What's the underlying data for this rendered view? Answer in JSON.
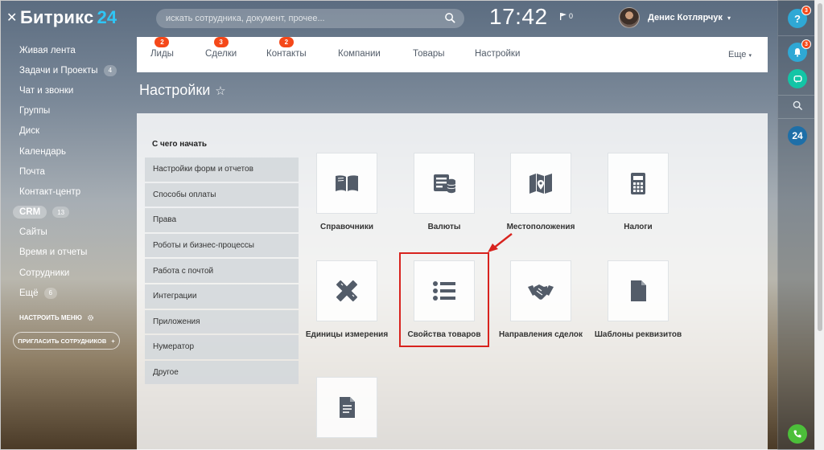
{
  "app": {
    "logo_text": "Битрикс",
    "logo_num": "24",
    "close_glyph": "✕"
  },
  "topbar": {
    "search_placeholder": "искать сотрудника, документ, прочее...",
    "time": "17:42",
    "flag_count": "0",
    "user_name": "Денис Котлярчук"
  },
  "leftnav": {
    "items": [
      {
        "label": "Живая лента"
      },
      {
        "label": "Задачи и Проекты",
        "count": "4"
      },
      {
        "label": "Чат и звонки"
      },
      {
        "label": "Группы"
      },
      {
        "label": "Диск"
      },
      {
        "label": "Календарь"
      },
      {
        "label": "Почта"
      },
      {
        "label": "Контакт-центр"
      },
      {
        "label": "CRM",
        "count": "13"
      },
      {
        "label": "Сайты"
      },
      {
        "label": "Время и отчеты"
      },
      {
        "label": "Сотрудники"
      },
      {
        "label": "Ещё",
        "count": "6"
      }
    ],
    "setup_label": "НАСТРОИТЬ МЕНЮ",
    "invite_label": "ПРИГЛАСИТЬ СОТРУДНИКОВ",
    "invite_plus": "+"
  },
  "rightbar": {
    "help_badge": "3",
    "bell_badge": "3",
    "help_glyph": "?",
    "b24_glyph": "24"
  },
  "crm_tabs": {
    "tabs": [
      {
        "label": "Лиды",
        "badge": "2"
      },
      {
        "label": "Сделки",
        "badge": "3"
      },
      {
        "label": "Контакты",
        "badge": "2"
      },
      {
        "label": "Компании"
      },
      {
        "label": "Товары"
      },
      {
        "label": "Настройки"
      }
    ],
    "more_label": "Еще"
  },
  "page": {
    "title": "Настройки",
    "star_glyph": "☆"
  },
  "settings": {
    "start_heading": "С чего начать",
    "menu": [
      "Настройки форм и отчетов",
      "Способы оплаты",
      "Права",
      "Роботы и бизнес-процессы",
      "Работа с почтой",
      "Интеграции",
      "Приложения",
      "Нумератор",
      "Другое"
    ],
    "tiles": [
      {
        "label": "Справочники",
        "icon": "book-icon"
      },
      {
        "label": "Валюты",
        "icon": "currency-icon"
      },
      {
        "label": "Местоположения",
        "icon": "map-pin-icon"
      },
      {
        "label": "Налоги",
        "icon": "calculator-icon"
      },
      {
        "label": "Единицы измерения",
        "icon": "ruler-pencil-icon"
      },
      {
        "label": "Свойства товаров",
        "icon": "list-icon"
      },
      {
        "label": "Направления сделок",
        "icon": "handshake-icon"
      },
      {
        "label": "Шаблоны реквизитов",
        "icon": "file-icon"
      },
      {
        "label": "",
        "icon": "document-icon"
      }
    ]
  },
  "colors": {
    "accent": "#2fc6f6",
    "badge": "#f54819",
    "highlight": "#d8231e",
    "icon": "#535c69"
  }
}
